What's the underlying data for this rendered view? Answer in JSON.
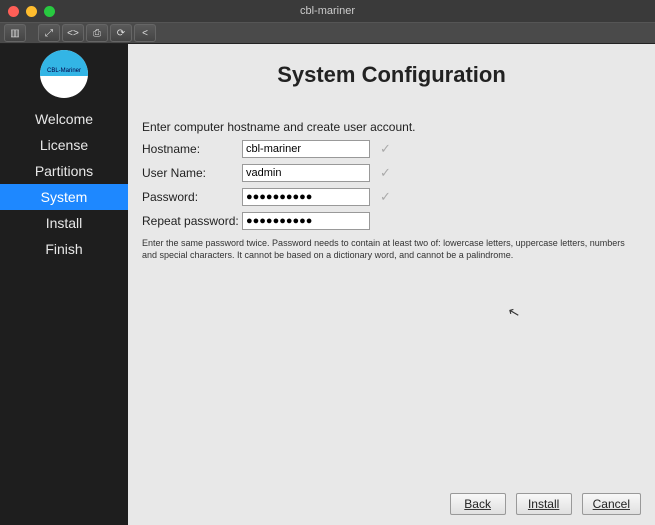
{
  "window": {
    "title": "cbl-mariner"
  },
  "sidebar": {
    "logo_text": "CBL-Mariner",
    "items": [
      {
        "label": "Welcome"
      },
      {
        "label": "License"
      },
      {
        "label": "Partitions"
      },
      {
        "label": "System"
      },
      {
        "label": "Install"
      },
      {
        "label": "Finish"
      }
    ],
    "active_index": 3
  },
  "main": {
    "title": "System Configuration",
    "intro": "Enter computer hostname and create user account.",
    "fields": {
      "hostname": {
        "label": "Hostname:",
        "value": "cbl-mariner"
      },
      "username": {
        "label": "User Name:",
        "value": "vadmin"
      },
      "password": {
        "label": "Password:",
        "value": "●●●●●●●●●●"
      },
      "repeat": {
        "label": "Repeat password:",
        "value": "●●●●●●●●●●"
      }
    },
    "hint": "Enter the same password twice. Password needs to contain at least two of: lowercase letters, uppercase letters, numbers and special characters. It cannot be based on a dictionary word, and cannot be a palindrome."
  },
  "footer": {
    "back": "Back",
    "install": "Install",
    "cancel": "Cancel"
  }
}
